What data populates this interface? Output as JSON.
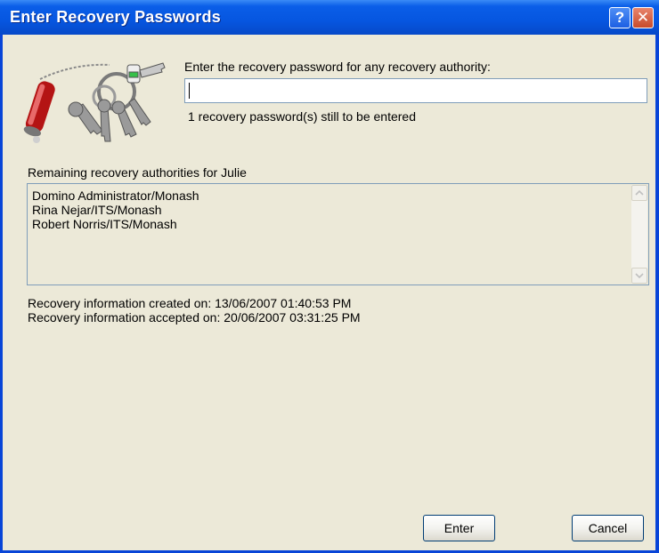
{
  "window": {
    "title": "Enter Recovery Passwords",
    "help_label": "?",
    "close_label": "✕"
  },
  "prompt": {
    "label": "Enter the recovery password for any recovery authority:",
    "password_value": "",
    "remaining_text": "1 recovery password(s) still to be entered"
  },
  "authorities": {
    "label": "Remaining recovery authorities for Julie",
    "items": [
      "Domino Administrator/Monash",
      "Rina Nejar/ITS/Monash",
      "Robert Norris/ITS/Monash"
    ]
  },
  "info": {
    "created": "Recovery information created on: 13/06/2007 01:40:53 PM",
    "accepted": "Recovery information accepted on: 20/06/2007 03:31:25 PM"
  },
  "buttons": {
    "enter": "Enter",
    "cancel": "Cancel"
  },
  "icons": {
    "keys": "keyring-flashlight-icon",
    "help": "help-icon",
    "close": "close-icon",
    "scroll_up": "scroll-up-arrow-icon",
    "scroll_down": "scroll-down-arrow-icon"
  },
  "colors": {
    "titlebar": "#0656e0",
    "window_frame": "#0845d8",
    "dialog_bg": "#ece9d8",
    "close_button": "#c84b2a"
  }
}
